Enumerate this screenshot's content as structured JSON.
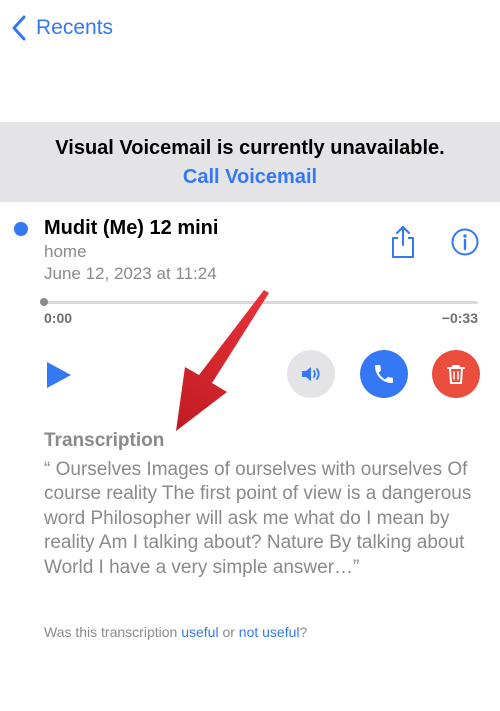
{
  "nav": {
    "back_label": "Recents"
  },
  "banner": {
    "title": "Visual Voicemail is currently unavailable.",
    "link": "Call Voicemail"
  },
  "voicemail": {
    "caller": "Mudit (Me) 12 mini",
    "label": "home",
    "date": "June 12, 2023 at 11:24",
    "time_start": "0:00",
    "time_end": "−0:33",
    "progress": 0
  },
  "transcription": {
    "title": "Transcription",
    "text": "“ Ourselves Images of ourselves with ourselves Of course reality The first point of view is a dangerous word Philosopher will ask me what do I mean by reality Am I talking about? Nature By talking about World I have a very simple answer…”"
  },
  "feedback": {
    "prefix": "Was this transcription ",
    "useful": "useful",
    "or": " or ",
    "not_useful": "not useful",
    "suffix": "?"
  },
  "colors": {
    "accent": "#3478f6",
    "delete": "#eb4d3d",
    "annotation_arrow": "#d9262a"
  },
  "icons": [
    "chevron-left-icon",
    "share-icon",
    "info-icon",
    "play-icon",
    "speaker-icon",
    "phone-icon",
    "trash-icon",
    "annotation-arrow"
  ]
}
